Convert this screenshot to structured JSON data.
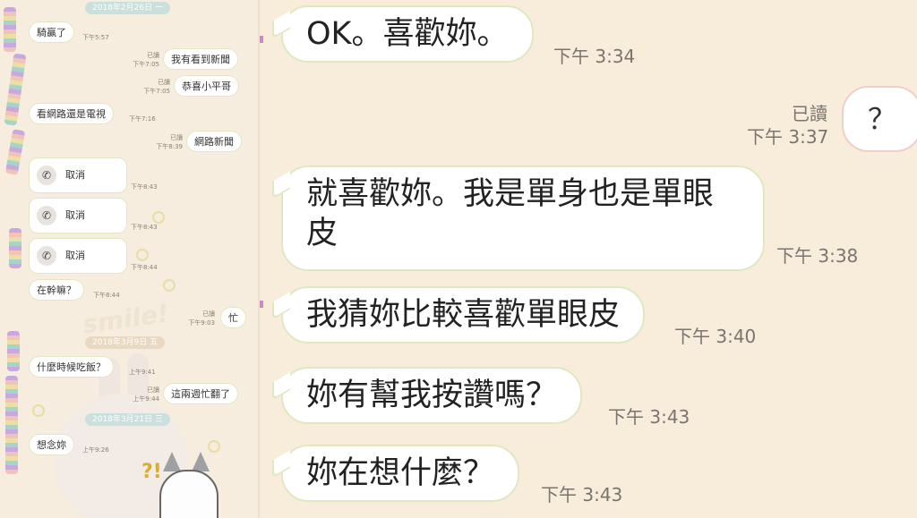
{
  "left_chat": {
    "dates": [
      "2018年2月26日 一",
      "2018年3月9日 五",
      "2018年3月21日 三"
    ],
    "messages": [
      {
        "text": "騎贏了",
        "time": "下午5:57"
      },
      {
        "text": "我有看到新聞",
        "time": "下午7:05",
        "read": "已讀"
      },
      {
        "text": "恭喜小平哥",
        "time": "下午7:05",
        "read": "已讀"
      },
      {
        "text": "看網路還是電視",
        "time": "下午7:16"
      },
      {
        "text": "網路新聞",
        "time": "下午8:39",
        "read": "已讀"
      },
      {
        "text": "取消",
        "time": "下午8:43"
      },
      {
        "text": "取消",
        "time": "下午8:43"
      },
      {
        "text": "取消",
        "time": "下午8:44"
      },
      {
        "text": "在幹嘛？",
        "time": "下午8:44"
      },
      {
        "text": "忙",
        "time": "下午9:03",
        "read": "已讀"
      },
      {
        "text": "什麼時候吃飯？",
        "time": "上午9:41"
      },
      {
        "text": "這兩週忙翻了",
        "time": "上午9:44",
        "read": "已讀"
      },
      {
        "text": "想念妳",
        "time": "上午9:26"
      }
    ],
    "decor_text": "smile!",
    "call_icon": "phone-icon"
  },
  "right_chat": {
    "messages": [
      {
        "text": "OK。喜歡妳。",
        "time": "下午 3:34"
      },
      {
        "text": "？",
        "time": "下午 3:37",
        "read": "已讀"
      },
      {
        "text": "就喜歡妳。我是單身也是單眼皮",
        "time": "下午 3:38"
      },
      {
        "text": "我猜妳比較喜歡單眼皮",
        "time": "下午 3:40"
      },
      {
        "text": "妳有幫我按讚嗎？",
        "time": "下午 3:43"
      },
      {
        "text": "妳在想什麼？",
        "time": "下午 3:43"
      }
    ]
  },
  "colors": {
    "left_bg": "#f6eddf",
    "right_bg": "#f8ecdb",
    "bubble_border": "#dfe8c3",
    "sent_border": "#f0cfc6",
    "date_pill": "#c9e0dc"
  }
}
